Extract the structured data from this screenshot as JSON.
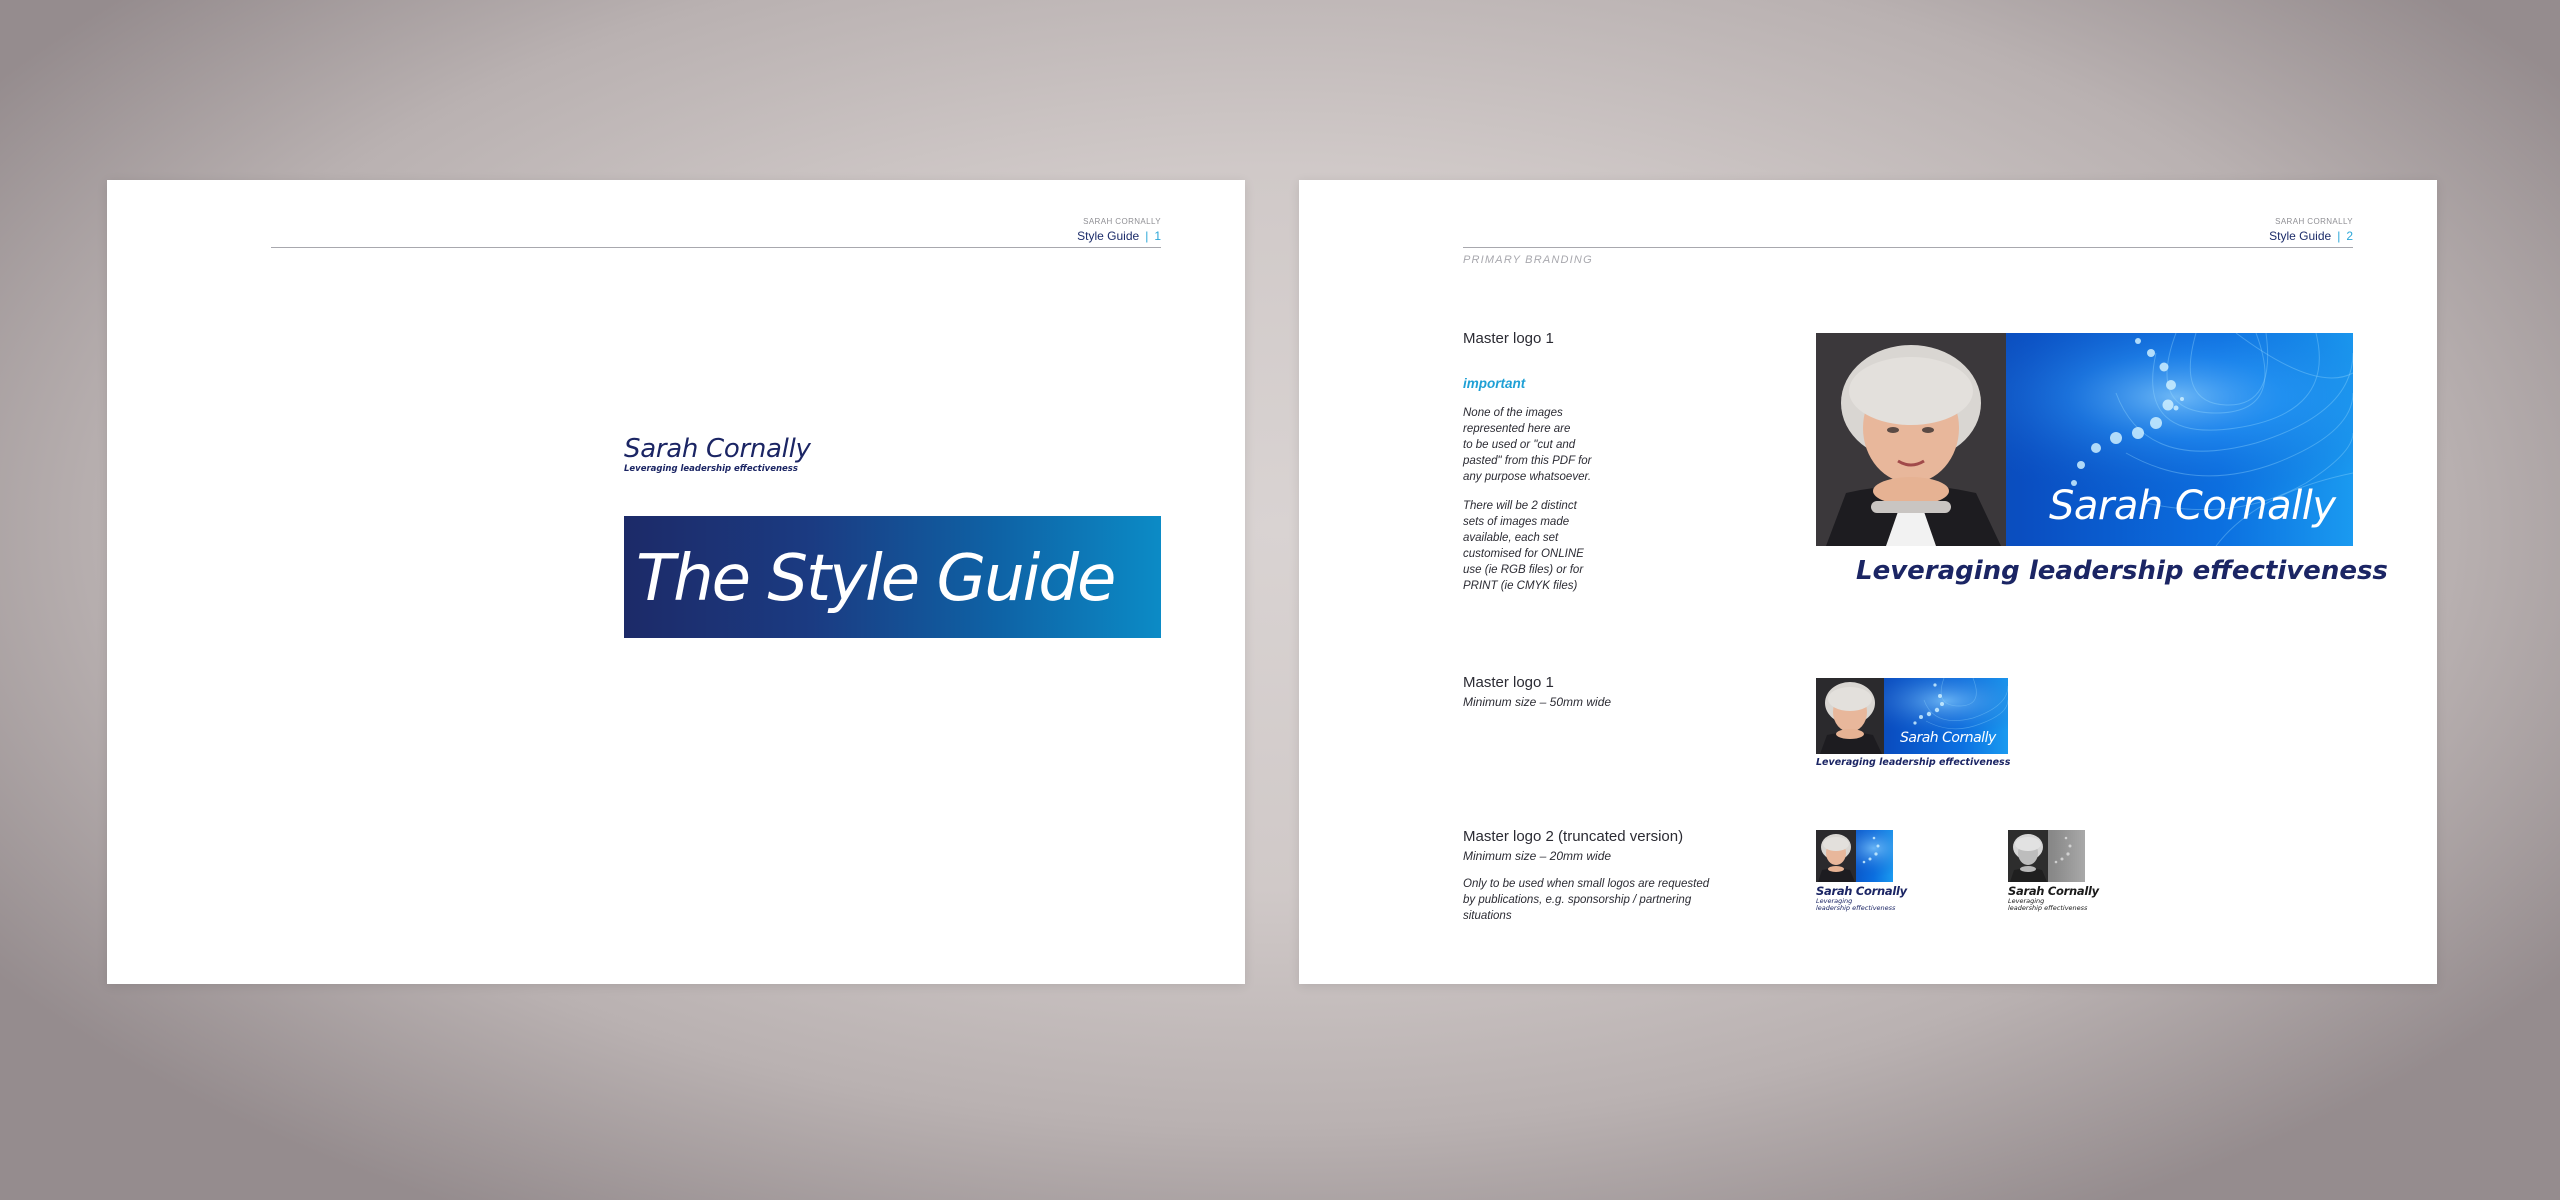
{
  "header": {
    "name": "SARAH CORNALLY",
    "guide_label": "Style Guide",
    "separator": "|"
  },
  "left_page": {
    "page_number": "1",
    "brand_name": "Sarah Cornally",
    "brand_tagline": "Leveraging leadership effectiveness",
    "cover_title": "The Style Guide"
  },
  "right_page": {
    "page_number": "2",
    "section_label": "PRIMARY BRANDING",
    "block1": {
      "label": "Master logo 1",
      "important": "important",
      "note1": [
        "None of the images",
        "represented here are",
        "to be used or \"cut and",
        "pasted\" from this PDF for",
        "any purpose whatsoever."
      ],
      "note2": [
        "There will be 2 distinct",
        "sets of images made",
        "available, each set",
        "customised for ONLINE",
        "use (ie RGB files) or for",
        "PRINT (ie CMYK files)"
      ]
    },
    "block2": {
      "label": "Master logo 1",
      "sub": "Minimum size – 50mm wide"
    },
    "block3": {
      "label": "Master logo 2 (truncated version)",
      "sub": "Minimum size – 20mm wide",
      "note": [
        "Only to be used when small logos are requested",
        "by publications, e.g. sponsorship / partnering",
        "situations"
      ]
    },
    "logo": {
      "name": "Sarah Cornally",
      "tagline": "Leveraging leadership effectiveness",
      "small_tag_line1": "Leveraging",
      "small_tag_line2": "leadership effectiveness"
    },
    "colors": {
      "navy": "#1b2564",
      "accent_blue": "#1fa0d5",
      "logo_blue": "#0a4fc2"
    }
  }
}
